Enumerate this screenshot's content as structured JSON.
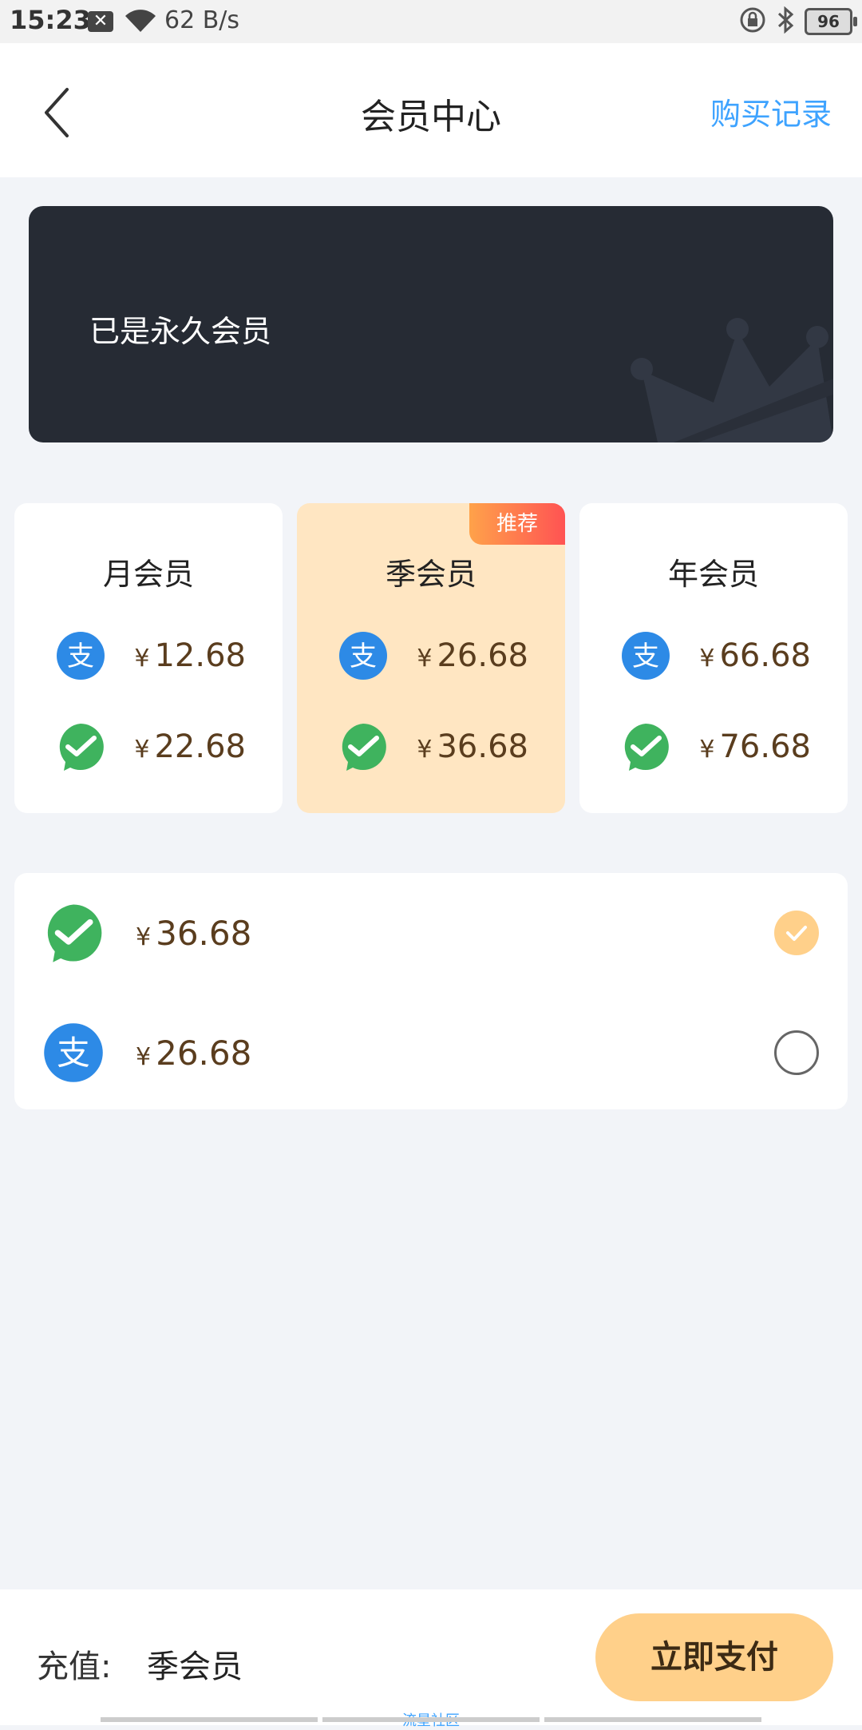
{
  "status_bar": {
    "time": "15:23",
    "speed": "62 B/s",
    "battery": "96"
  },
  "header": {
    "title": "会员中心",
    "records": "购买记录"
  },
  "banner": {
    "text": "已是永久会员"
  },
  "plans": [
    {
      "name": "月会员",
      "alipay_price": "12.68",
      "wechat_price": "22.68",
      "selected": false
    },
    {
      "name": "季会员",
      "alipay_price": "26.68",
      "wechat_price": "36.68",
      "selected": true,
      "badge": "推荐"
    },
    {
      "name": "年会员",
      "alipay_price": "66.68",
      "wechat_price": "76.68",
      "selected": false
    }
  ],
  "currency": "¥",
  "payment_methods": [
    {
      "method": "wechat",
      "price": "36.68",
      "selected": true
    },
    {
      "method": "alipay",
      "price": "26.68",
      "selected": false
    }
  ],
  "footer": {
    "charge_label": "充值:",
    "charge_value": "季会员",
    "pay_button": "立即支付"
  },
  "watermark": "流星社区",
  "colors": {
    "accent": "#3ea3ff",
    "selected_bg": "#ffe6c2",
    "button": "#ffd08a",
    "banner": "#262b34",
    "alipay": "#2d8ae6",
    "wechat": "#3fb35e"
  },
  "icons": {
    "alipay": "alipay-icon",
    "wechat": "wechat-pay-icon"
  }
}
